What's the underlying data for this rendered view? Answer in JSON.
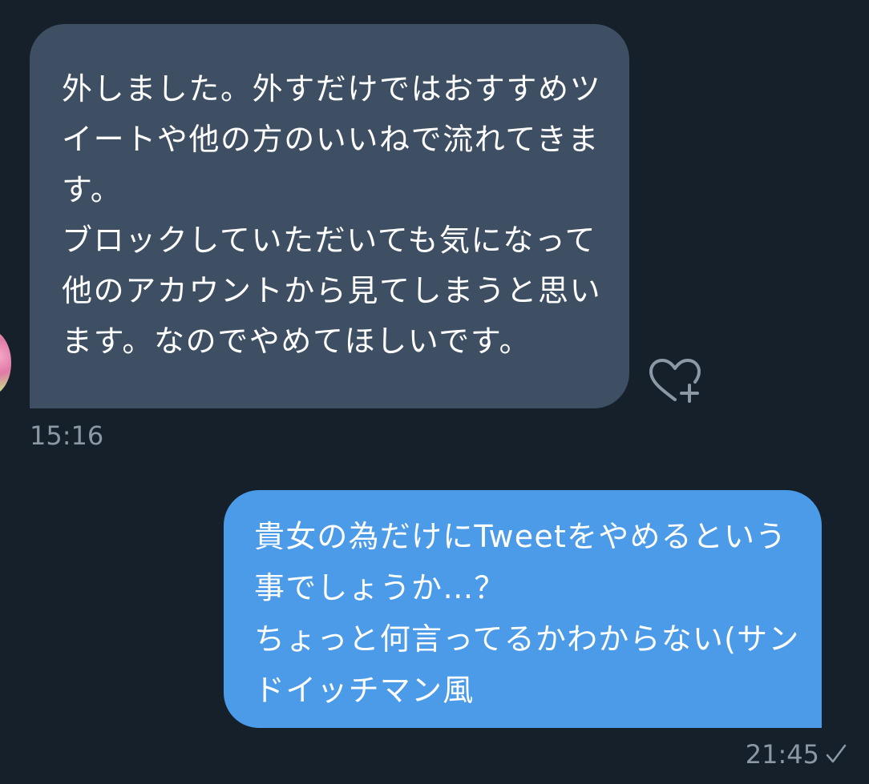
{
  "conversation": {
    "messages": [
      {
        "direction": "received",
        "text": "外しました。外すだけではおすすめツイートや他の方のいいねで流れてきます。\nブロックしていただいても気になって他のアカウントから見てしまうと思います。なのでやめてほしいです。",
        "time": "15:16"
      },
      {
        "direction": "sent",
        "text": "貴女の為だけにTweetをやめるという事でしょうか…？\nちょっと何言ってるかわからない(サンドイッチマン風",
        "time": "21:45"
      }
    ]
  },
  "icons": {
    "avatar": "user-avatar",
    "like": "heart-plus-icon",
    "status": "check-icon"
  },
  "colors": {
    "background": "#15202b",
    "received_bubble": "#3f4f63",
    "sent_bubble": "#4c9be8",
    "timestamp": "#8b98a5"
  }
}
